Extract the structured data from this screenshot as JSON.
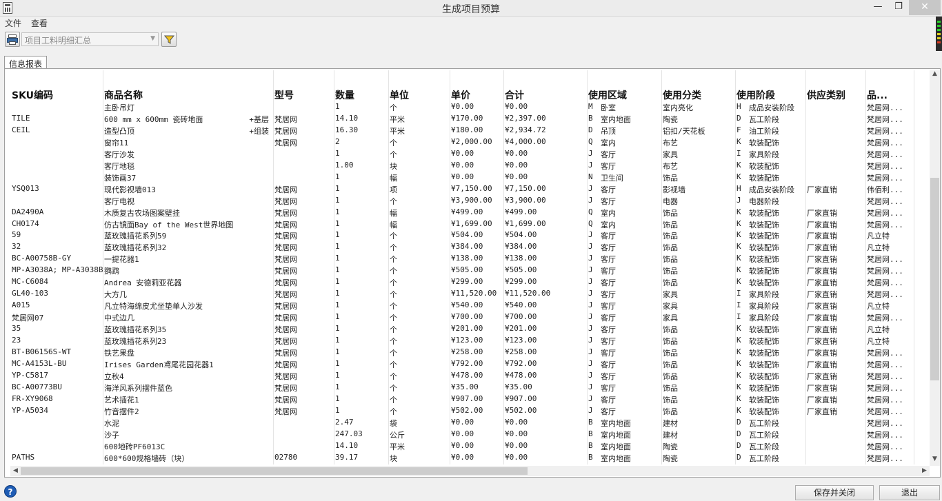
{
  "window": {
    "title": "生成项目预算"
  },
  "menu": {
    "file": "文件",
    "view": "查看"
  },
  "toolbar": {
    "report_select": "项目工料明细汇总"
  },
  "tabs": {
    "info_report": "信息报表"
  },
  "table": {
    "headers": [
      "SKU编码",
      "商品名称",
      "型号",
      "数量",
      "单位",
      "单价",
      "合计",
      "使用区域",
      "使用分类",
      "使用阶段",
      "供应类别",
      "品..."
    ],
    "rows": [
      [
        "",
        "主卧吊灯",
        "",
        "1",
        "个",
        "¥0.00",
        "¥0.00",
        "M",
        "卧室",
        "室内亮化",
        "H",
        "成品安装阶段",
        "",
        "梵居网..."
      ],
      [
        "TILE",
        "600 mm x 600mm 瓷砖地面",
        "+基层",
        "梵居网",
        "14.10",
        "平米",
        "¥170.00",
        "¥2,397.00",
        "B",
        "室内地面",
        "陶瓷",
        "D",
        "瓦工阶段",
        "",
        "梵居网..."
      ],
      [
        "CEIL",
        "造型凸顶",
        "+组装",
        "梵居网",
        "16.30",
        "平米",
        "¥180.00",
        "¥2,934.72",
        "D",
        "吊顶",
        "铝扣/天花板",
        "F",
        "油工阶段",
        "",
        "梵居网..."
      ],
      [
        "",
        "窗帘11",
        "梵居网",
        "2",
        "个",
        "¥2,000.00",
        "¥4,000.00",
        "Q",
        "室内",
        "布艺",
        "K",
        "软装配饰",
        "",
        "梵居网..."
      ],
      [
        "",
        "客厅沙发",
        "",
        "1",
        "个",
        "¥0.00",
        "¥0.00",
        "J",
        "客厅",
        "家具",
        "I",
        "家具阶段",
        "",
        "梵居网..."
      ],
      [
        "",
        "客厅地毯",
        "",
        "1.00",
        "块",
        "¥0.00",
        "¥0.00",
        "J",
        "客厅",
        "布艺",
        "K",
        "软装配饰",
        "",
        "梵居网..."
      ],
      [
        "",
        "装饰画37",
        "",
        "1",
        "幅",
        "¥0.00",
        "¥0.00",
        "N",
        "卫生间",
        "饰品",
        "K",
        "软装配饰",
        "",
        "梵居网..."
      ],
      [
        "YSQ013",
        "现代影视墙013",
        "梵居网",
        "1",
        "项",
        "¥7,150.00",
        "¥7,150.00",
        "J",
        "客厅",
        "影视墙",
        "H",
        "成品安装阶段",
        "厂家直销",
        "伟佰利..."
      ],
      [
        "",
        "客厅电视",
        "梵居网",
        "1",
        "个",
        "¥3,900.00",
        "¥3,900.00",
        "J",
        "客厅",
        "电器",
        "J",
        "电器阶段",
        "",
        "梵居网..."
      ],
      [
        "DA2490A",
        "木质复古农场图案壁挂",
        "梵居网",
        "1",
        "幅",
        "¥499.00",
        "¥499.00",
        "Q",
        "室内",
        "饰品",
        "K",
        "软装配饰",
        "厂家直销",
        "梵居网..."
      ],
      [
        "CH0174",
        "仿古镜面Bay of the West世界地图",
        "梵居网",
        "1",
        "幅",
        "¥1,699.00",
        "¥1,699.00",
        "Q",
        "室内",
        "饰品",
        "K",
        "软装配饰",
        "厂家直销",
        "梵居网..."
      ],
      [
        "59",
        "蓝玫瑰插花系列59",
        "梵居网",
        "1",
        "个",
        "¥504.00",
        "¥504.00",
        "J",
        "客厅",
        "饰品",
        "K",
        "软装配饰",
        "厂家直销",
        "凡立特"
      ],
      [
        "32",
        "蓝玫瑰插花系列32",
        "梵居网",
        "1",
        "个",
        "¥384.00",
        "¥384.00",
        "J",
        "客厅",
        "饰品",
        "K",
        "软装配饰",
        "厂家直销",
        "凡立特"
      ],
      [
        "BC-A00758B-GY",
        "一提花器1",
        "梵居网",
        "1",
        "个",
        "¥138.00",
        "¥138.00",
        "J",
        "客厅",
        "饰品",
        "K",
        "软装配饰",
        "厂家直销",
        "梵居网..."
      ],
      [
        "MP-A3038A; MP-A3038B",
        "鹦鹉",
        "梵居网",
        "1",
        "个",
        "¥505.00",
        "¥505.00",
        "J",
        "客厅",
        "饰品",
        "K",
        "软装配饰",
        "厂家直销",
        "梵居网..."
      ],
      [
        "MC-C6084",
        "Andrea 安德莉亚花器",
        "梵居网",
        "1",
        "个",
        "¥299.00",
        "¥299.00",
        "J",
        "客厅",
        "饰品",
        "K",
        "软装配饰",
        "厂家直销",
        "梵居网..."
      ],
      [
        "GL40-103",
        "大方几",
        "梵居网",
        "1",
        "个",
        "¥11,520.00",
        "¥11,520.00",
        "J",
        "客厅",
        "家具",
        "I",
        "家具阶段",
        "厂家直销",
        "梵居网..."
      ],
      [
        "A015",
        "凡立特海绵皮尤坐垫单人沙发",
        "梵居网",
        "1",
        "个",
        "¥540.00",
        "¥540.00",
        "J",
        "客厅",
        "家具",
        "I",
        "家具阶段",
        "厂家直销",
        "凡立特"
      ],
      [
        "梵居网07",
        "中式边几",
        "梵居网",
        "1",
        "个",
        "¥700.00",
        "¥700.00",
        "J",
        "客厅",
        "家具",
        "I",
        "家具阶段",
        "厂家直销",
        "梵居网..."
      ],
      [
        "35",
        "蓝玫瑰插花系列35",
        "梵居网",
        "1",
        "个",
        "¥201.00",
        "¥201.00",
        "J",
        "客厅",
        "饰品",
        "K",
        "软装配饰",
        "厂家直销",
        "凡立特"
      ],
      [
        "23",
        "蓝玫瑰插花系列23",
        "梵居网",
        "1",
        "个",
        "¥123.00",
        "¥123.00",
        "J",
        "客厅",
        "饰品",
        "K",
        "软装配饰",
        "厂家直销",
        "凡立特"
      ],
      [
        "BT-B06156S-WT",
        "铁艺果盘",
        "梵居网",
        "1",
        "个",
        "¥258.00",
        "¥258.00",
        "J",
        "客厅",
        "饰品",
        "K",
        "软装配饰",
        "厂家直销",
        "梵居网..."
      ],
      [
        "MC-A4153L-BU",
        "Irises Garden鸢尾花园花器1",
        "梵居网",
        "1",
        "个",
        "¥792.00",
        "¥792.00",
        "J",
        "客厅",
        "饰品",
        "K",
        "软装配饰",
        "厂家直销",
        "梵居网..."
      ],
      [
        "YP-C5817",
        "立秋4",
        "梵居网",
        "1",
        "个",
        "¥478.00",
        "¥478.00",
        "J",
        "客厅",
        "饰品",
        "K",
        "软装配饰",
        "厂家直销",
        "梵居网..."
      ],
      [
        "BC-A00773BU",
        "海洋风系列摆件蓝色",
        "梵居网",
        "1",
        "个",
        "¥35.00",
        "¥35.00",
        "J",
        "客厅",
        "饰品",
        "K",
        "软装配饰",
        "厂家直销",
        "梵居网..."
      ],
      [
        "FR-XY9068",
        "艺术插花1",
        "梵居网",
        "1",
        "个",
        "¥907.00",
        "¥907.00",
        "J",
        "客厅",
        "饰品",
        "K",
        "软装配饰",
        "厂家直销",
        "梵居网..."
      ],
      [
        "YP-A5034",
        "竹音摆件2",
        "梵居网",
        "1",
        "个",
        "¥502.00",
        "¥502.00",
        "J",
        "客厅",
        "饰品",
        "K",
        "软装配饰",
        "厂家直销",
        "梵居网..."
      ],
      [
        "",
        "水泥",
        "",
        "2.47",
        "袋",
        "¥0.00",
        "¥0.00",
        "B",
        "室内地面",
        "建材",
        "D",
        "瓦工阶段",
        "",
        "梵居网..."
      ],
      [
        "",
        "沙子",
        "",
        "247.03",
        "公斤",
        "¥0.00",
        "¥0.00",
        "B",
        "室内地面",
        "建材",
        "D",
        "瓦工阶段",
        "",
        "梵居网..."
      ],
      [
        "",
        "600地砖PF6013C",
        "",
        "14.10",
        "平米",
        "¥0.00",
        "¥0.00",
        "B",
        "室内地面",
        "陶瓷",
        "D",
        "瓦工阶段",
        "",
        "梵居网..."
      ],
      [
        "PATHS",
        "600*600规格墙砖（块）",
        "02780",
        "39.17",
        "块",
        "¥0.00",
        "¥0.00",
        "B",
        "室内地面",
        "陶瓷",
        "D",
        "瓦工阶段",
        "",
        "梵居网..."
      ]
    ]
  },
  "buttons": {
    "save_close": "保存并关闭",
    "exit": "退出",
    "help": "?"
  },
  "icons": {
    "app": "calculator-icon",
    "print": "print-icon",
    "filter": "filter-icon"
  },
  "colors": {
    "accent": "#1f5db5"
  }
}
